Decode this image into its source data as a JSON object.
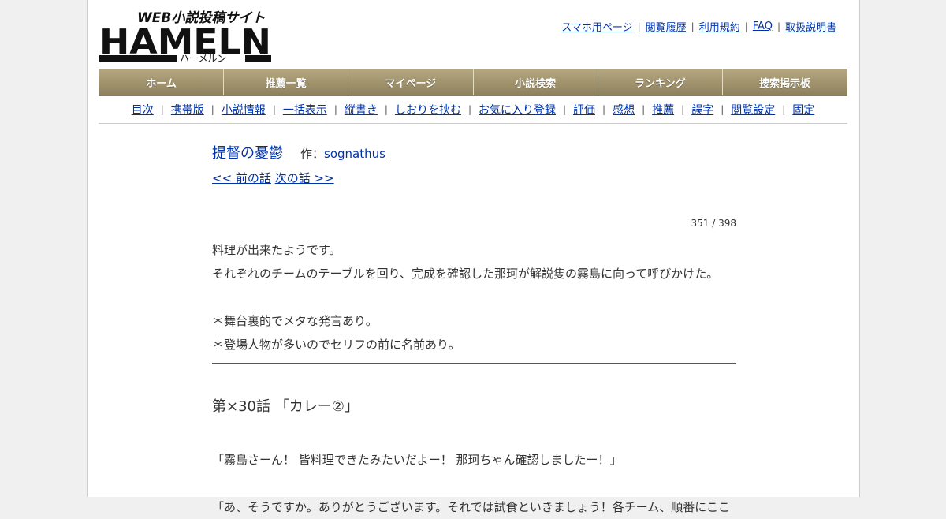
{
  "header": {
    "logo_tagline": "WEB小説投稿サイト",
    "logo_name": "HAMELN",
    "logo_kana": "ハーメルン",
    "top_links": [
      "スマホ用ページ",
      "閲覧履歴",
      "利用規約",
      "FAQ",
      "取扱説明書"
    ]
  },
  "global_nav": [
    "ホーム",
    "推薦一覧",
    "マイページ",
    "小説検索",
    "ランキング",
    "捜索掲示板"
  ],
  "sub_nav": [
    "目次",
    "携帯版",
    "小説情報",
    "一括表示",
    "縦書き",
    "しおりを挟む",
    "お気に入り登録",
    "評価",
    "感想",
    "推薦",
    "誤字",
    "閲覧設定",
    "固定"
  ],
  "novel": {
    "title": "提督の憂鬱",
    "author_label": "作：",
    "author": "sognathus",
    "prev": "<< 前の話",
    "next": "次の話 >>",
    "counter": "351 / 398"
  },
  "preface": [
    "料理が出来たようです。",
    "それぞれのチームのテーブルを回り、完成を確認した那珂が解説隻の霧島に向って呼びかけた。",
    "",
    "＊舞台裏的でメタな発言あり。",
    "＊登場人物が多いのでセリフの前に名前あり。"
  ],
  "chapter_title": "第×30話 「カレー②」",
  "body": [
    "「霧島さーん！ 皆料理できたみたいだよー！ 那珂ちゃん確認しましたー！」",
    "",
    "「あ、そうですか。ありがとうございます。それでは試食といきましょう！各チーム、順番にここ"
  ],
  "colors": {
    "nav_bg": "#a1946d",
    "link": "#0033aa"
  }
}
